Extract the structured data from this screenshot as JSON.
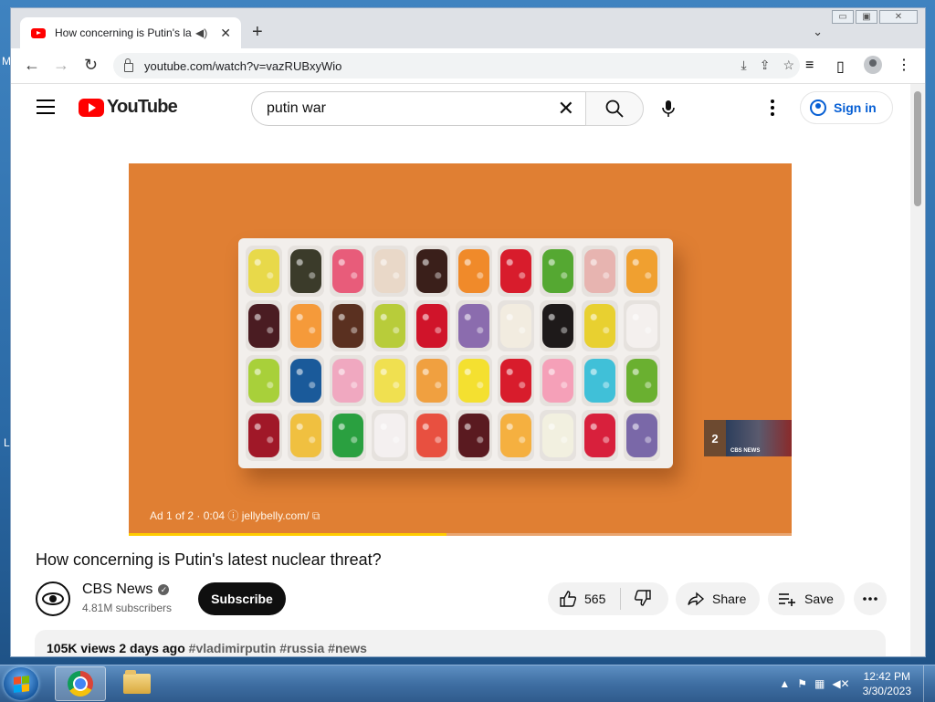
{
  "browser": {
    "tab_title": "How concerning is Putin's latest nuclear threat? - YouTube",
    "url": "youtube.com/watch?v=vazRUBxyWio"
  },
  "youtube": {
    "logo_text": "YouTube",
    "search_value": "putin war",
    "sign_in_label": "Sign in"
  },
  "player": {
    "ad_label": "Ad 1 of 2 · 0:04",
    "ad_domain": "jellybelly.com/",
    "next_ad_number": "2",
    "next_ad_thumb_text": "CBS NEWS",
    "ad_progress": 0.48,
    "jellybean_colors": [
      [
        "#e8d94a",
        "#3b3b2a",
        "#e85c7a",
        "#e9d8c8",
        "#3a1f1a",
        "#f08a2a",
        "#d81c2c",
        "#55a832",
        "#e7b4b0",
        "#f0a030"
      ],
      [
        "#4a1c22",
        "#f59a3a",
        "#5a3020",
        "#b8cc3a",
        "#d0142a",
        "#8b6cae",
        "#f2ece0",
        "#1e1a1a",
        "#e8d030",
        "#f4f0ee"
      ],
      [
        "#a8d03a",
        "#1a5a9a",
        "#f0a8c0",
        "#f0e050",
        "#f0a040",
        "#f4e030",
        "#d81c2c",
        "#f5a0b8",
        "#40c0d8",
        "#6ab030"
      ],
      [
        "#a01828",
        "#f0c040",
        "#2aa040",
        "#f4f0f0",
        "#e85040",
        "#5a1a20",
        "#f5b040",
        "#f2f0e0",
        "#d8203c",
        "#7a68a8"
      ]
    ]
  },
  "video": {
    "title": "How concerning is Putin's latest nuclear threat?",
    "channel_name": "CBS News",
    "subscribers": "4.81M subscribers",
    "subscribe_label": "Subscribe",
    "likes": "565",
    "share_label": "Share",
    "save_label": "Save",
    "views_date": "105K views  2 days ago",
    "hashtags": "#vladimirputin #russia #news"
  },
  "taskbar": {
    "time": "12:42 PM",
    "date": "3/30/2023"
  },
  "colors": {
    "ad_background": "#e07f33",
    "youtube_red": "#ff0000",
    "link_blue": "#065fd4",
    "ad_progress": "#ffcc00"
  }
}
